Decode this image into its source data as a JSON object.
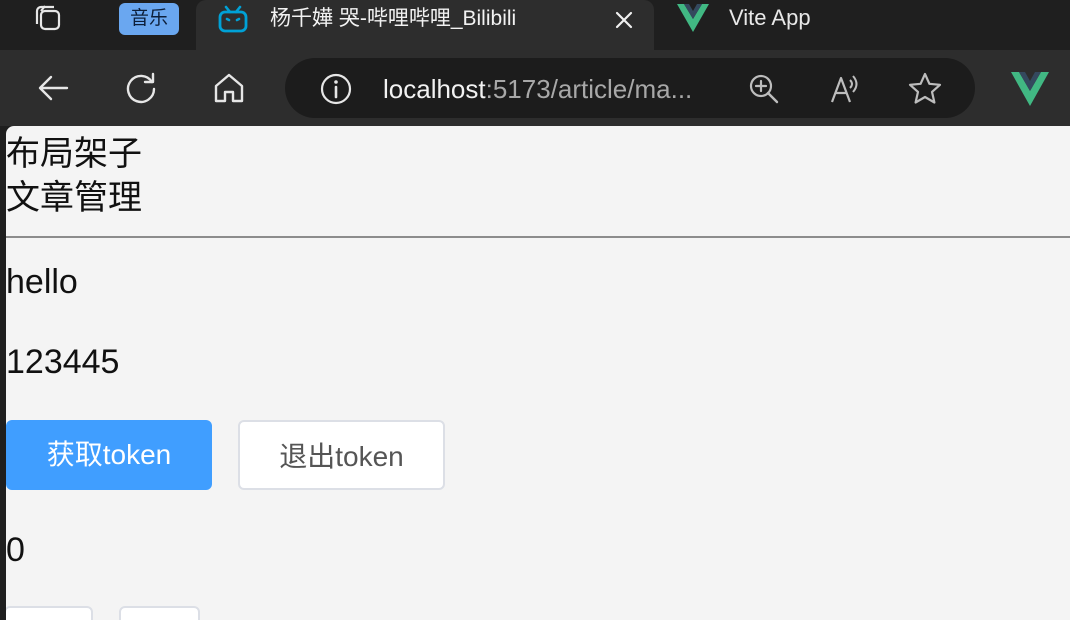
{
  "browser": {
    "tabs": [
      {
        "label": "音乐",
        "type": "badge"
      },
      {
        "label": "杨千嬅 哭-哔哩哔哩_Bilibili",
        "active": true
      },
      {
        "label": "Vite App"
      }
    ],
    "address": {
      "host": "localhost",
      "path": ":5173/article/ma..."
    },
    "colors": {
      "bilibili_blue": "#00a1d6",
      "vue_green": "#41b883",
      "vue_dark": "#34495e",
      "badge_blue": "#6aa7f0"
    },
    "icons": [
      "workspaces-icon",
      "bilibili-icon",
      "close-icon",
      "vue-icon",
      "back-icon",
      "refresh-icon",
      "home-icon",
      "info-icon",
      "zoom-icon",
      "read-aloud-icon",
      "favorite-icon"
    ]
  },
  "page": {
    "layout_title": "布局架子",
    "menu_item": "文章管理",
    "greeting": "hello",
    "number": "123445",
    "buttons": {
      "get_token": "获取token",
      "logout_token": "退出token"
    },
    "counter": "0",
    "colors": {
      "primary": "#409eff",
      "background": "#f4f4f4"
    }
  }
}
